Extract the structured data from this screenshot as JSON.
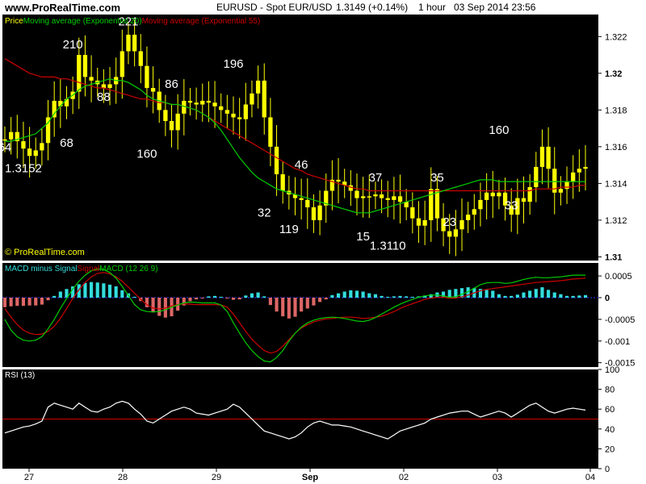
{
  "header": {
    "site": "www.ProRealTime.com",
    "symbol": "EURUSD - Spot EUR/USD",
    "price": "1.3149 (+0.14%)",
    "timeframe": "1 hour",
    "datetime": "03 Sep 2014 23:56"
  },
  "watermark": "© ProRealTime.com",
  "colors": {
    "price": "#ffff00",
    "ema20": "#00cc00",
    "ema55": "#cc0000",
    "macd_hist_pos": "#33dddd",
    "macd_hist_neg": "#dd6666",
    "macd_line": "#00cc00",
    "signal_line": "#cc0000",
    "rsi_line": "#ffffff",
    "rsi_ref": "#cc0000",
    "background": "#000000"
  },
  "legends": {
    "price": [
      {
        "text": "Price",
        "color": "#ffff00"
      },
      {
        "text": " Moving average (Exponential 20)",
        "color": "#00cc00"
      },
      {
        "text": " Moving average (Exponential 55)",
        "color": "#cc0000"
      }
    ],
    "macd": [
      {
        "text": "MACD minus Signal",
        "color": "#33dddd"
      },
      {
        "text": " Signal",
        "color": "#cc0000"
      },
      {
        "text": " MACD (12 26 9)",
        "color": "#00cc00"
      }
    ],
    "rsi": [
      {
        "text": "RSI (13)",
        "color": "#ffffff"
      }
    ]
  },
  "x_axis_labels": [
    "27",
    "28",
    "29",
    "Sep",
    "02",
    "03",
    "04"
  ],
  "chart_data": [
    {
      "type": "candlestick",
      "panel": "price",
      "ylim": [
        1.3098,
        1.3232
      ],
      "yticks": [
        "1.322",
        "1.32",
        "1.318",
        "1.316",
        "1.314",
        "1.312",
        "1.31"
      ],
      "bold_ticks": [
        "1.32",
        "1.31"
      ],
      "series": [
        {
          "name": "Price",
          "color": "#ffff00",
          "values": [
            1.3164,
            1.3168,
            1.3163,
            1.3159,
            1.3155,
            1.3158,
            1.3162,
            1.3176,
            1.3185,
            1.3182,
            1.3186,
            1.319,
            1.321,
            1.3198,
            1.3196,
            1.3194,
            1.3192,
            1.3194,
            1.3198,
            1.3212,
            1.3221,
            1.3212,
            1.3204,
            1.3192,
            1.319,
            1.318,
            1.3174,
            1.3169,
            1.3178,
            1.3185,
            1.3184,
            1.3183,
            1.3185,
            1.3184,
            1.3182,
            1.318,
            1.3178,
            1.3176,
            1.3175,
            1.3183,
            1.3189,
            1.3196,
            1.3176,
            1.316,
            1.3145,
            1.3136,
            1.3134,
            1.3132,
            1.3131,
            1.3127,
            1.312,
            1.3128,
            1.3136,
            1.3142,
            1.3141,
            1.3139,
            1.3136,
            1.3132,
            1.3133,
            1.3133,
            1.3134,
            1.3132,
            1.3131,
            1.3133,
            1.313,
            1.3127,
            1.3121,
            1.3117,
            1.312,
            1.3137,
            1.3121,
            1.3114,
            1.3111,
            1.3115,
            1.312,
            1.3123,
            1.3126,
            1.3131,
            1.3135,
            1.3133,
            1.3135,
            1.3128,
            1.3123,
            1.3132,
            1.313,
            1.3138,
            1.3149,
            1.316,
            1.3148,
            1.3135,
            1.3137,
            1.3141,
            1.3146,
            1.3148,
            1.3149
          ]
        },
        {
          "name": "Moving average (Exponential 20)",
          "color": "#00cc00",
          "values": [
            1.3163,
            1.3163,
            1.3164,
            1.3165,
            1.3166,
            1.3167,
            1.317,
            1.3173,
            1.3178,
            1.3182,
            1.3186,
            1.3188,
            1.3191,
            1.3193,
            1.3194,
            1.3195,
            1.3196,
            1.3197,
            1.3196,
            1.3196,
            1.3195,
            1.3193,
            1.3191,
            1.3188,
            1.3186,
            1.3185,
            1.3184,
            1.3183,
            1.3183,
            1.3182,
            1.3181,
            1.318,
            1.3178,
            1.3176,
            1.3173,
            1.3169,
            1.3164,
            1.3159,
            1.3154,
            1.315,
            1.3146,
            1.3143,
            1.3141,
            1.3139,
            1.3137,
            1.3136,
            1.3135,
            1.3134,
            1.3133,
            1.3132,
            1.3131,
            1.313,
            1.3129,
            1.3128,
            1.3127,
            1.3126,
            1.3125,
            1.3124,
            1.3124,
            1.3124,
            1.3125,
            1.3126,
            1.3127,
            1.3128,
            1.3129,
            1.313,
            1.3131,
            1.3132,
            1.3133,
            1.3134,
            1.3135,
            1.3136,
            1.3137,
            1.3138,
            1.3139,
            1.314,
            1.3141,
            1.3142,
            1.3142,
            1.3142,
            1.3141,
            1.3141,
            1.3141,
            1.3141,
            1.3141,
            1.3141,
            1.3141,
            1.3141,
            1.3141,
            1.3141,
            1.3141,
            1.3141,
            1.3141,
            1.3141,
            1.3141
          ]
        },
        {
          "name": "Moving average (Exponential 55)",
          "color": "#cc0000",
          "values": [
            1.3208,
            1.3206,
            1.3204,
            1.3202,
            1.32,
            1.3199,
            1.3198,
            1.3198,
            1.3198,
            1.3197,
            1.3197,
            1.3196,
            1.3195,
            1.3194,
            1.3193,
            1.3192,
            1.3192,
            1.3191,
            1.319,
            1.3189,
            1.3188,
            1.3187,
            1.3186,
            1.3186,
            1.3185,
            1.3184,
            1.3184,
            1.3183,
            1.3183,
            1.3182,
            1.3181,
            1.318,
            1.3178,
            1.3176,
            1.3174,
            1.3172,
            1.317,
            1.3168,
            1.3166,
            1.3164,
            1.3162,
            1.316,
            1.3158,
            1.3156,
            1.3154,
            1.3152,
            1.315,
            1.3148,
            1.3147,
            1.3145,
            1.3144,
            1.3143,
            1.3142,
            1.3141,
            1.314,
            1.3139,
            1.3138,
            1.3137,
            1.3137,
            1.3136,
            1.3136,
            1.3136,
            1.3136,
            1.3136,
            1.3136,
            1.3136,
            1.3136,
            1.3136,
            1.3136,
            1.3136,
            1.3136,
            1.3136,
            1.3136,
            1.3136,
            1.3136,
            1.3136,
            1.3136,
            1.3136,
            1.3136,
            1.3136,
            1.3136,
            1.3136,
            1.3136,
            1.3136,
            1.3136,
            1.3136,
            1.3137,
            1.3137,
            1.3137,
            1.3137,
            1.3138,
            1.3138,
            1.3138,
            1.3139,
            1.3139
          ]
        }
      ],
      "annotations": [
        {
          "text": "64",
          "i": 0,
          "price": 1.31575
        },
        {
          "text": "1.3152",
          "i": 3,
          "price": 1.3146
        },
        {
          "text": "68",
          "i": 10,
          "price": 1.316
        },
        {
          "text": "210",
          "i": 11,
          "price": 1.32135
        },
        {
          "text": "88",
          "i": 16,
          "price": 1.3185
        },
        {
          "text": "221",
          "i": 20,
          "price": 1.3226
        },
        {
          "text": "160",
          "i": 23,
          "price": 1.3154
        },
        {
          "text": "86",
          "i": 27,
          "price": 1.3192
        },
        {
          "text": "196",
          "i": 37,
          "price": 1.3203
        },
        {
          "text": "46",
          "i": 48,
          "price": 1.3148
        },
        {
          "text": "32",
          "i": 42,
          "price": 1.3122
        },
        {
          "text": "119",
          "i": 46,
          "price": 1.3113
        },
        {
          "text": "37",
          "i": 60,
          "price": 1.3141
        },
        {
          "text": "15",
          "i": 58,
          "price": 1.3109
        },
        {
          "text": "1.3110",
          "i": 62,
          "price": 1.3104
        },
        {
          "text": "35",
          "i": 70,
          "price": 1.3141
        },
        {
          "text": "23",
          "i": 72,
          "price": 1.3117
        },
        {
          "text": "160",
          "i": 80,
          "price": 1.3167
        },
        {
          "text": "33",
          "i": 82,
          "price": 1.3126
        }
      ]
    },
    {
      "type": "bar",
      "panel": "macd",
      "ylim": [
        -0.0016,
        0.0008
      ],
      "yticks": [
        "0.0005",
        "0",
        "-0.0005",
        "-0.001",
        "-0.0015"
      ],
      "bold_ticks": [
        "0"
      ],
      "series": [
        {
          "name": "MACD minus Signal",
          "color": "#33dddd",
          "values": [
            -0.00022,
            -0.0002,
            -0.00019,
            -0.00019,
            -0.00018,
            -0.00018,
            -0.00016,
            -6e-05,
            4e-05,
            0.00014,
            0.0002,
            0.00026,
            0.00031,
            0.00034,
            0.00036,
            0.00035,
            0.00033,
            0.0003,
            0.00026,
            0.00017,
            0.0001,
            2e-05,
            -8e-05,
            -0.00022,
            -0.00034,
            -0.00042,
            -0.00046,
            -0.00043,
            -0.0003,
            -0.00018,
            -8e-05,
            -4e-05,
            -2e-05,
            3e-05,
            4e-05,
            2e-05,
            -2e-05,
            -5e-05,
            -4e-05,
            5e-05,
            0.0001,
            0.00012,
            3e-05,
            -0.00017,
            -0.00032,
            -0.00043,
            -0.00048,
            -0.00044,
            -0.00032,
            -0.00025,
            -0.00018,
            -0.0001,
            -4e-05,
            6e-05,
            0.0001,
            0.00014,
            0.00017,
            0.00016,
            0.00014,
            0.0001,
            8e-05,
            4e-05,
            2e-05,
            3e-05,
            4e-05,
            3e-05,
            2e-05,
            3e-05,
            5e-05,
            8e-05,
            0.00012,
            0.00014,
            0.00018,
            0.0002,
            0.00022,
            0.00024,
            0.00022,
            0.0002,
            0.00018,
            0.00016,
            8e-05,
            4e-05,
            4e-05,
            7e-05,
            0.00012,
            0.00016,
            0.0002,
            0.00024,
            0.00018,
            0.00012,
            8e-05,
            4e-05,
            4e-05,
            5e-05,
            6e-05
          ]
        },
        {
          "name": "Signal",
          "color": "#cc0000",
          "values": [
            -0.00025,
            -0.00045,
            -0.00062,
            -0.00075,
            -0.00082,
            -0.00085,
            -0.00084,
            -0.00078,
            -0.00066,
            -0.00048,
            -0.00025,
            -2e-05,
            0.00018,
            0.00035,
            0.00048,
            0.00056,
            0.00058,
            0.00055,
            0.00048,
            0.00038,
            0.00024,
            0.0001,
            -4e-05,
            -0.00016,
            -0.00024,
            -0.00026,
            -0.00024,
            -0.00019,
            -0.00016,
            -0.00014,
            -0.00015,
            -0.00016,
            -0.00016,
            -0.00016,
            -0.00016,
            -0.00017,
            -0.00022,
            -0.00038,
            -0.00058,
            -0.00078,
            -0.00096,
            -0.0011,
            -0.00122,
            -0.00128,
            -0.00124,
            -0.00112,
            -0.00097,
            -0.00082,
            -0.0007,
            -0.00062,
            -0.00056,
            -0.00052,
            -0.00049,
            -0.00048,
            -0.00046,
            -0.00045,
            -0.00045,
            -0.00046,
            -0.00048,
            -0.00047,
            -0.00045,
            -0.00043,
            -0.00038,
            -0.00032,
            -0.00025,
            -0.00019,
            -0.00014,
            -9e-05,
            -4e-05,
            -1e-05,
            1e-05,
            1e-05,
            -1e-05,
            -1e-05,
            2e-05,
            6e-05,
            0.00011,
            0.00016,
            0.00019,
            0.00021,
            0.00023,
            0.00025,
            0.00027,
            0.00029,
            0.00031,
            0.00033,
            0.00035,
            0.00036,
            0.00037,
            0.00038,
            0.00039,
            0.00041,
            0.00043,
            0.00044,
            0.00045
          ]
        },
        {
          "name": "MACD (12 26 9)",
          "color": "#00cc00",
          "values": [
            -0.0005,
            -0.00075,
            -0.0009,
            -0.00098,
            -0.001,
            -0.00098,
            -0.0009,
            -0.00072,
            -0.0005,
            -0.00025,
            -2e-05,
            0.0002,
            0.00038,
            0.00052,
            0.00062,
            0.00066,
            0.00065,
            0.00058,
            0.00045,
            0.00026,
            5e-05,
            -0.00016,
            -0.00028,
            -0.00032,
            -0.00033,
            -0.00032,
            -0.00028,
            -0.00022,
            -0.00017,
            -0.00012,
            -0.0001,
            -0.00011,
            -0.00012,
            -0.00012,
            -0.00012,
            -0.00017,
            -0.00032,
            -0.00058,
            -0.00082,
            -0.00104,
            -0.00122,
            -0.00136,
            -0.00146,
            -0.00148,
            -0.00138,
            -0.00122,
            -0.001,
            -0.00082,
            -0.00068,
            -0.00058,
            -0.00052,
            -0.00048,
            -0.00046,
            -0.00045,
            -0.00046,
            -0.00048,
            -0.00051,
            -0.00054,
            -0.00055,
            -0.00052,
            -0.00046,
            -0.00038,
            -0.0003,
            -0.00022,
            -0.00015,
            -9e-05,
            -4e-05,
            1e-05,
            4e-05,
            6e-05,
            6e-05,
            4e-05,
            1e-05,
            2e-05,
            8e-05,
            0.00014,
            0.00022,
            0.0003,
            0.00034,
            0.00035,
            0.00035,
            0.00033,
            0.00034,
            0.00038,
            0.00042,
            0.00045,
            0.00047,
            0.00046,
            0.00046,
            0.00047,
            0.00048,
            0.0005,
            0.00052,
            0.00052,
            0.00052
          ]
        }
      ]
    },
    {
      "type": "line",
      "panel": "rsi",
      "ylim": [
        0,
        100
      ],
      "yticks": [
        "100",
        "80",
        "60",
        "40",
        "20",
        "0"
      ],
      "reference_line": 50,
      "series": [
        {
          "name": "RSI (13)",
          "color": "#ffffff",
          "values": [
            36,
            38,
            40,
            42,
            43,
            45,
            48,
            62,
            66,
            64,
            62,
            60,
            66,
            62,
            58,
            57,
            60,
            62,
            66,
            68,
            66,
            60,
            55,
            48,
            46,
            50,
            54,
            58,
            60,
            62,
            60,
            56,
            55,
            54,
            56,
            58,
            60,
            65,
            62,
            56,
            50,
            44,
            38,
            36,
            34,
            32,
            30,
            32,
            36,
            42,
            46,
            48,
            46,
            44,
            44,
            43,
            42,
            40,
            38,
            36,
            34,
            32,
            30,
            34,
            38,
            40,
            42,
            44,
            46,
            50,
            52,
            54,
            56,
            57,
            58,
            58,
            55,
            52,
            54,
            56,
            58,
            56,
            52,
            56,
            60,
            64,
            66,
            62,
            58,
            56,
            58,
            60,
            61,
            60,
            59
          ]
        }
      ]
    }
  ]
}
